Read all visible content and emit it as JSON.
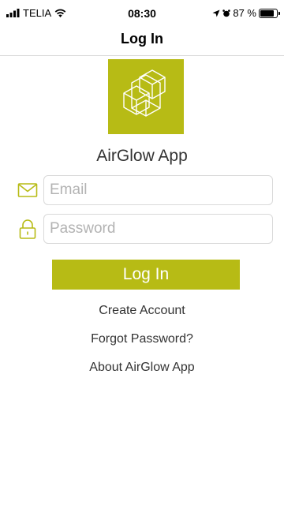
{
  "status_bar": {
    "carrier": "TELIA",
    "time": "08:30",
    "battery_percent": "87 %",
    "battery_level": 0.87
  },
  "nav": {
    "title": "Log In"
  },
  "app": {
    "name": "AirGlow App"
  },
  "form": {
    "email_placeholder": "Email",
    "password_placeholder": "Password",
    "login_label": "Log In"
  },
  "links": {
    "create_account": "Create Account",
    "forgot_password": "Forgot Password?",
    "about": "About AirGlow App"
  },
  "colors": {
    "accent": "#b7bb15",
    "text": "#333333",
    "placeholder": "#b3b3b3",
    "border": "#d9d9d9"
  },
  "icons": {
    "status": [
      "signal-icon",
      "wifi-icon",
      "location-icon",
      "alarm-icon",
      "battery-icon"
    ],
    "fields": [
      "mail-icon",
      "lock-icon"
    ],
    "logo": "hexagon-cubes-logo"
  }
}
